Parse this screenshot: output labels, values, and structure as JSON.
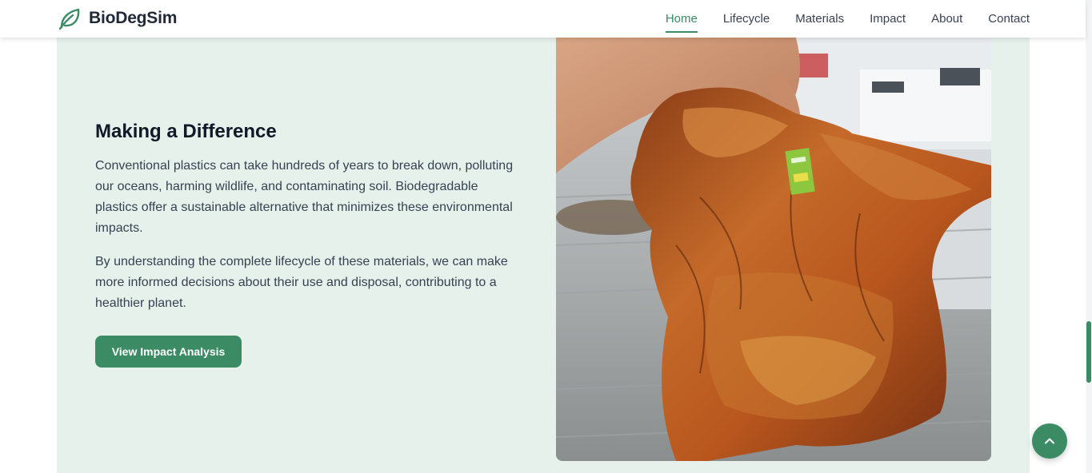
{
  "brand": {
    "name": "BioDegSim",
    "icon": "leaf-icon"
  },
  "nav": {
    "items": [
      {
        "label": "Home",
        "active": true
      },
      {
        "label": "Lifecycle",
        "active": false
      },
      {
        "label": "Materials",
        "active": false
      },
      {
        "label": "Impact",
        "active": false
      },
      {
        "label": "About",
        "active": false
      },
      {
        "label": "Contact",
        "active": false
      }
    ]
  },
  "section": {
    "heading": "Making a Difference",
    "paragraphs": [
      "Conventional plastics can take hundreds of years to break down, polluting our oceans, harming wildlife, and contaminating soil. Biodegradable plastics offer a sustainable alternative that minimizes these environmental impacts.",
      "By understanding the complete lifecycle of these materials, we can make more informed decisions about their use and disposal, contributing to a healthier planet."
    ],
    "cta_label": "View Impact Analysis"
  },
  "scroll_to_top": {
    "icon": "chevron-up-icon"
  },
  "colors": {
    "accent": "#3b8c65",
    "section_bg": "#e6f1ec",
    "text": "#374151",
    "heading": "#111827"
  }
}
